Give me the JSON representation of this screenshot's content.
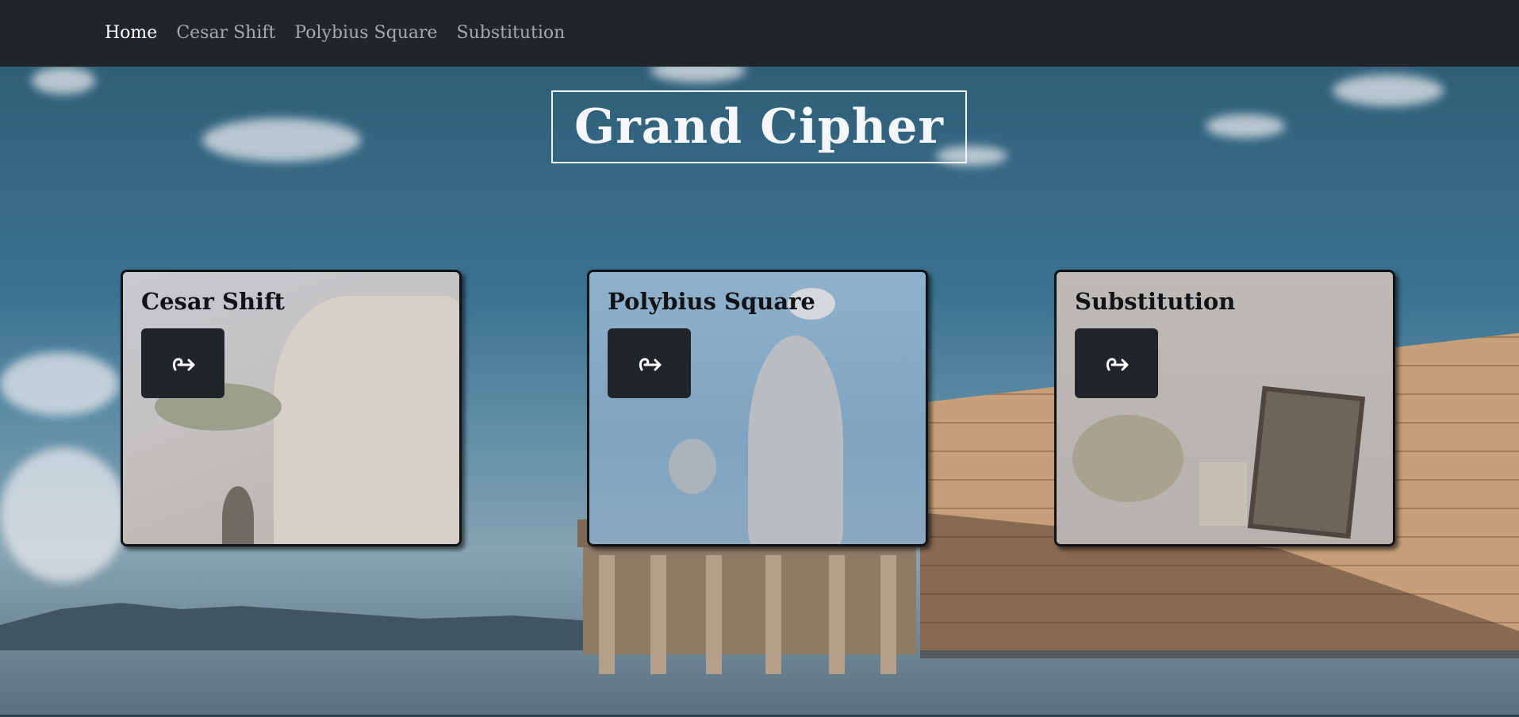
{
  "nav": {
    "items": [
      {
        "label": "Home",
        "active": true
      },
      {
        "label": "Cesar Shift",
        "active": false
      },
      {
        "label": "Polybius Square",
        "active": false
      },
      {
        "label": "Substitution",
        "active": false
      }
    ]
  },
  "hero": {
    "title": "Grand Cipher"
  },
  "cards": [
    {
      "title": "Cesar Shift",
      "button_icon": "arrow-hook-right-icon"
    },
    {
      "title": "Polybius Square",
      "button_icon": "arrow-hook-right-icon"
    },
    {
      "title": "Substitution",
      "button_icon": "arrow-hook-right-icon"
    }
  ],
  "colors": {
    "navbar_bg": "#212429",
    "nav_active": "#ffffff",
    "nav_inactive": "#a6a8ab",
    "button_bg": "#212429",
    "title_text": "#f5f7fa"
  }
}
